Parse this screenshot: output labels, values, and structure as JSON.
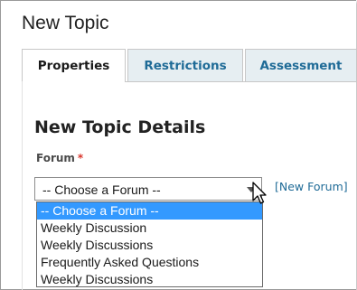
{
  "page": {
    "title": "New Topic"
  },
  "tabs": [
    {
      "label": "Properties",
      "active": true
    },
    {
      "label": "Restrictions",
      "active": false
    },
    {
      "label": "Assessment",
      "active": false
    }
  ],
  "section": {
    "heading": "New Topic Details"
  },
  "forum_field": {
    "label": "Forum",
    "required_mark": "*",
    "selected_value": "-- Choose a Forum --",
    "new_forum_link": "[New Forum]",
    "options": [
      {
        "label": "-- Choose a Forum --",
        "highlighted": true
      },
      {
        "label": "Weekly Discussion",
        "highlighted": false
      },
      {
        "label": "Weekly Discussions",
        "highlighted": false
      },
      {
        "label": "Frequently Asked Questions",
        "highlighted": false
      },
      {
        "label": "Weekly Discussions",
        "highlighted": false
      }
    ]
  },
  "colors": {
    "link": "#1f6b97",
    "inactive_tab_bg": "#e6eef2",
    "required": "#d9342b",
    "option_highlight": "#3399ff"
  },
  "icons": {
    "select_arrow": "chevron-down-icon",
    "cursor": "mouse-pointer-icon"
  }
}
